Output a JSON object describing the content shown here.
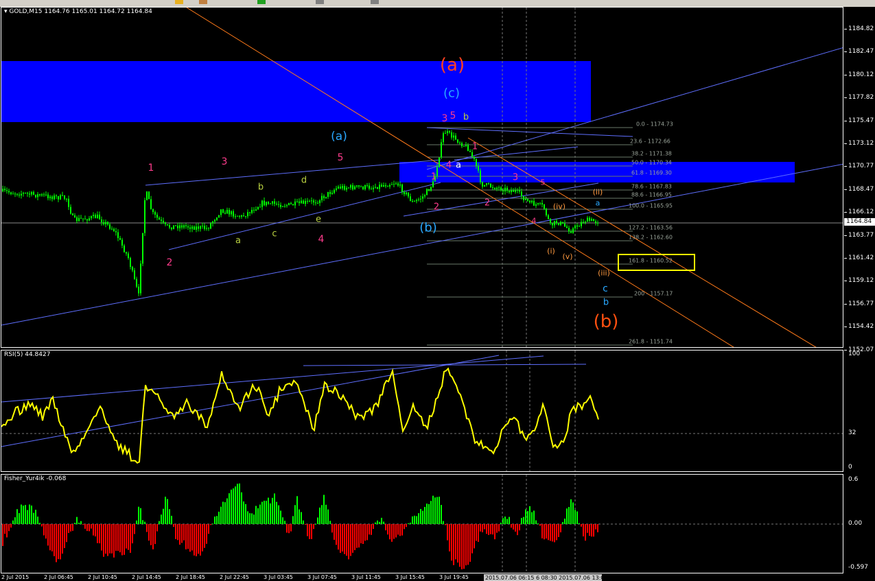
{
  "window": {
    "symbol_label": "GOLD,M15",
    "ohlc_label": "1164.76 1165.01 1164.72 1164.84"
  },
  "colors": {
    "background": "#000000",
    "candle": "#00ff00",
    "blue_zone": "#0000ff",
    "trend_line": "#5f6fff",
    "orange_line": "#ff7a1a",
    "rsi_line": "#ffff00",
    "hist_up": "#00ff00",
    "hist_down": "#ff0000",
    "target_box": "#ffff00"
  },
  "price_axis": {
    "ticks": [
      "1184.82",
      "1182.47",
      "1180.12",
      "1177.82",
      "1175.47",
      "1173.12",
      "1170.77",
      "1168.47",
      "1166.12",
      "1163.77",
      "1161.42",
      "1159.12",
      "1156.77",
      "1154.42",
      "1152.07"
    ],
    "current_price": "1164.84"
  },
  "fib_levels": [
    {
      "label": "0.0 - 1174.73"
    },
    {
      "label": "23.6 - 1172.66"
    },
    {
      "label": "38.2 - 1171.38"
    },
    {
      "label": "50.0 - 1170.34"
    },
    {
      "label": "61.8 - 1169.30"
    },
    {
      "label": "78.6 - 1167.83"
    },
    {
      "label": "88.6 - 1166.95"
    },
    {
      "label": "100.0 - 1165.95"
    },
    {
      "label": "127.2 - 1163.56"
    },
    {
      "label": "138.2 - 1162.60"
    },
    {
      "label": "161.8 - 1160.52"
    },
    {
      "label": "200 - 1157.17"
    },
    {
      "label": "261.8 - 1151.74"
    }
  ],
  "wave_labels": [
    {
      "text": "(a)",
      "color": "#ff4020"
    },
    {
      "text": "(c)",
      "color": "#29a8ff"
    },
    {
      "text": "(a)",
      "color": "#29a8ff"
    },
    {
      "text": "(b)",
      "color": "#29a8ff"
    },
    {
      "text": "(b)",
      "color": "#ff5010"
    },
    {
      "text": "1",
      "color": "#ff3c8c"
    },
    {
      "text": "2",
      "color": "#ff3c8c"
    },
    {
      "text": "3",
      "color": "#ff3c8c"
    },
    {
      "text": "4",
      "color": "#ff3c8c"
    },
    {
      "text": "5",
      "color": "#ff3c8c"
    },
    {
      "text": "a",
      "color": "#b8d040"
    },
    {
      "text": "b",
      "color": "#b8d040"
    },
    {
      "text": "c",
      "color": "#b8d040"
    },
    {
      "text": "d",
      "color": "#b8d040"
    },
    {
      "text": "e",
      "color": "#b8d040"
    },
    {
      "text": "3",
      "color": "#ff3c8c"
    },
    {
      "text": "5",
      "color": "#ff3c8c"
    },
    {
      "text": "b",
      "color": "#b8d040"
    },
    {
      "text": "4",
      "color": "#ff3c8c"
    },
    {
      "text": "a",
      "color": "#ffffff"
    },
    {
      "text": "1",
      "color": "#ff3c8c"
    },
    {
      "text": "2",
      "color": "#ff3c8c"
    },
    {
      "text": "1",
      "color": "#ff3c8c"
    },
    {
      "text": "2",
      "color": "#ff3c8c"
    },
    {
      "text": "3",
      "color": "#ff3c8c"
    },
    {
      "text": "4",
      "color": "#ff3c8c"
    },
    {
      "text": "5",
      "color": "#ff3c8c"
    },
    {
      "text": "(i)",
      "color": "#ff9a40"
    },
    {
      "text": "(ii)",
      "color": "#ff9a40"
    },
    {
      "text": "(iii)",
      "color": "#ff9a40"
    },
    {
      "text": "(iv)",
      "color": "#ff9a40"
    },
    {
      "text": "(v)",
      "color": "#ff9a40"
    },
    {
      "text": "a",
      "color": "#29a8ff"
    },
    {
      "text": "b",
      "color": "#29a8ff"
    },
    {
      "text": "c",
      "color": "#29a8ff"
    },
    {
      "text": "c",
      "color": "#b8d040"
    }
  ],
  "rsi": {
    "title": "RSI(5) 44.8427",
    "ticks": [
      "100",
      "32",
      "0"
    ]
  },
  "fisher": {
    "title": "Fisher_Yur4ik -0.068",
    "ticks": [
      "0.6",
      "0.00",
      "-0.597"
    ]
  },
  "time_axis": {
    "labels": [
      "2 Jul 2015",
      "2 Jul 06:45",
      "2 Jul 10:45",
      "2 Jul 14:45",
      "2 Jul 18:45",
      "2 Jul 22:45",
      "3 Jul 03:45",
      "3 Jul 07:45",
      "3 Jul 11:45",
      "3 Jul 15:45",
      "3 Jul 19:45"
    ],
    "highlight": "2015.07.06 06:15 6 08:30 2015.07.06 13:00"
  }
}
